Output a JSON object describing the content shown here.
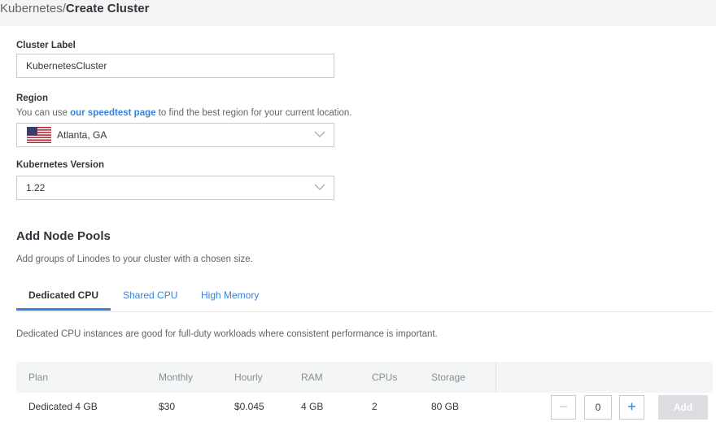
{
  "breadcrumb": {
    "parent": "Kubernetes",
    "separator": "/",
    "current": "Create Cluster"
  },
  "cluster_label": {
    "label": "Cluster Label",
    "value": "KubernetesCluster"
  },
  "region": {
    "label": "Region",
    "help_prefix": "You can use ",
    "help_link": "our speedtest page",
    "help_suffix": " to find the best region for your current location.",
    "selected": "Atlanta, GA",
    "flag": "us-flag-icon"
  },
  "k8s_version": {
    "label": "Kubernetes Version",
    "selected": "1.22"
  },
  "node_pools": {
    "title": "Add Node Pools",
    "subtitle": "Add groups of Linodes to your cluster with a chosen size.",
    "tabs": [
      {
        "label": "Dedicated CPU",
        "active": true
      },
      {
        "label": "Shared CPU",
        "active": false
      },
      {
        "label": "High Memory",
        "active": false
      }
    ],
    "description": "Dedicated CPU instances are good for full-duty workloads where consistent performance is important.",
    "columns": [
      "Plan",
      "Monthly",
      "Hourly",
      "RAM",
      "CPUs",
      "Storage"
    ],
    "rows": [
      {
        "plan": "Dedicated 4 GB",
        "monthly": "$30",
        "hourly": "$0.045",
        "ram": "4 GB",
        "cpus": "2",
        "storage": "80 GB",
        "quantity": "0"
      }
    ],
    "decrement_label": "−",
    "increment_label": "+",
    "add_label": "Add"
  },
  "colors": {
    "accent": "#3683dc",
    "header_bg": "#f4f4f4",
    "table_header_bg": "#f4f5f6",
    "disabled_button": "#dcdde0"
  }
}
